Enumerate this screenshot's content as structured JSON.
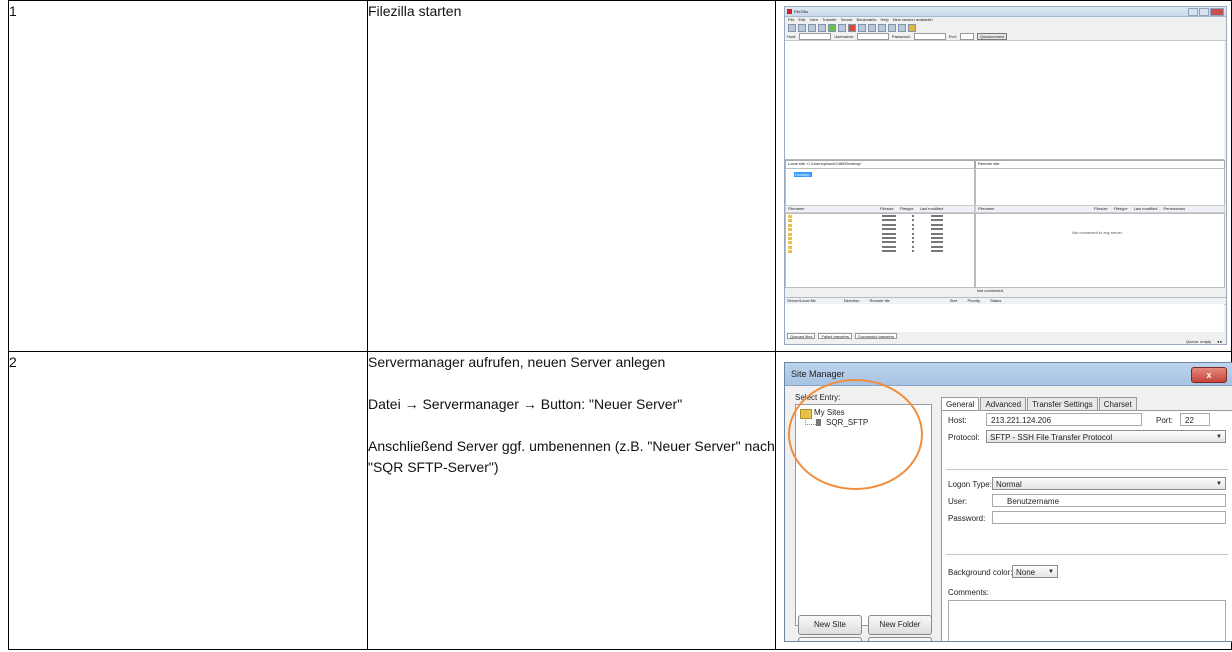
{
  "rows": [
    {
      "number": "1",
      "description": [
        "Filezilla starten"
      ]
    },
    {
      "number": "2",
      "description": [
        "Servermanager aufrufen, neuen Server anlegen",
        "Datei → Servermanager → Button: \"Neuer Server\"",
        "Anschließend Server ggf. umbenennen (z.B. \"Neuer Server\" nach \"SQR SFTP-Server\")"
      ]
    }
  ],
  "filezilla": {
    "title": "FileZilla",
    "menu": [
      "File",
      "Edit",
      "View",
      "Transfer",
      "Server",
      "Bookmarks",
      "Help",
      "New version available!"
    ],
    "quickconnect": {
      "host_label": "Host:",
      "user_label": "Username:",
      "password_label": "Password:",
      "port_label": "Port:",
      "button": "Quickconnect"
    },
    "local_site_label": "Local site:",
    "local_site_path": "C:\\Users\\plusch2469\\Desktop\\",
    "remote_site_label": "Remote site:",
    "tree_selected": "Desktop",
    "local_columns": [
      "Filename",
      "Filesize",
      "Filetype",
      "Last modified"
    ],
    "remote_columns": [
      "Filename",
      "Filesize",
      "Filetype",
      "Last modified",
      "Permissions"
    ],
    "not_connected_server": "Not connected to any server",
    "not_connected": "Not connected.",
    "queue_columns": [
      "Server/Local file",
      "Direction",
      "Remote file",
      "Size",
      "Priority",
      "Status"
    ],
    "queue_tabs": [
      "Queued files",
      "Failed transfers",
      "Successful transfers"
    ],
    "queue_status": "Queue: empty",
    "file_rows": [
      {
        "type": "Dateiordner",
        "size": "1",
        "time": "16:07:57"
      },
      {
        "type": "Dateiordner",
        "size": "1",
        "time": "12:31:18"
      },
      {
        "type": "Dateiordner",
        "size": "2",
        "time": "15:28:26"
      },
      {
        "type": "Dateiordner",
        "size": "2",
        "time": "16:47:35"
      },
      {
        "type": "Dateiordner",
        "size": "2",
        "time": "16:36:58"
      },
      {
        "type": "Dateiordner",
        "size": "2",
        "time": "16:06:12"
      },
      {
        "type": "Dateiordner",
        "size": "2",
        "time": "12:03:14"
      },
      {
        "type": "Dateiordner",
        "size": "2",
        "time": "16:47:37"
      },
      {
        "type": "Dateiordner",
        "size": "2",
        "time": "15:43:10"
      }
    ]
  },
  "site_manager": {
    "title": "Site Manager",
    "close": "x",
    "select_entry": "Select Entry:",
    "root": "My Sites",
    "entry": "SQR_SFTP",
    "tabs": [
      "General",
      "Advanced",
      "Transfer Settings",
      "Charset"
    ],
    "host_label": "Host:",
    "host_value": "213.221.124.206",
    "port_label": "Port:",
    "port_value": "22",
    "protocol_label": "Protocol:",
    "protocol_value": "SFTP - SSH File Transfer Protocol",
    "logon_label": "Logon Type:",
    "logon_value": "Normal",
    "user_label": "User:",
    "user_value": "Benutzername",
    "password_label": "Password:",
    "bg_label": "Background color:",
    "bg_value": "None",
    "comments_label": "Comments:",
    "new_site": "New Site",
    "new_folder": "New Folder",
    "accent_color": "#ef8d3c"
  }
}
